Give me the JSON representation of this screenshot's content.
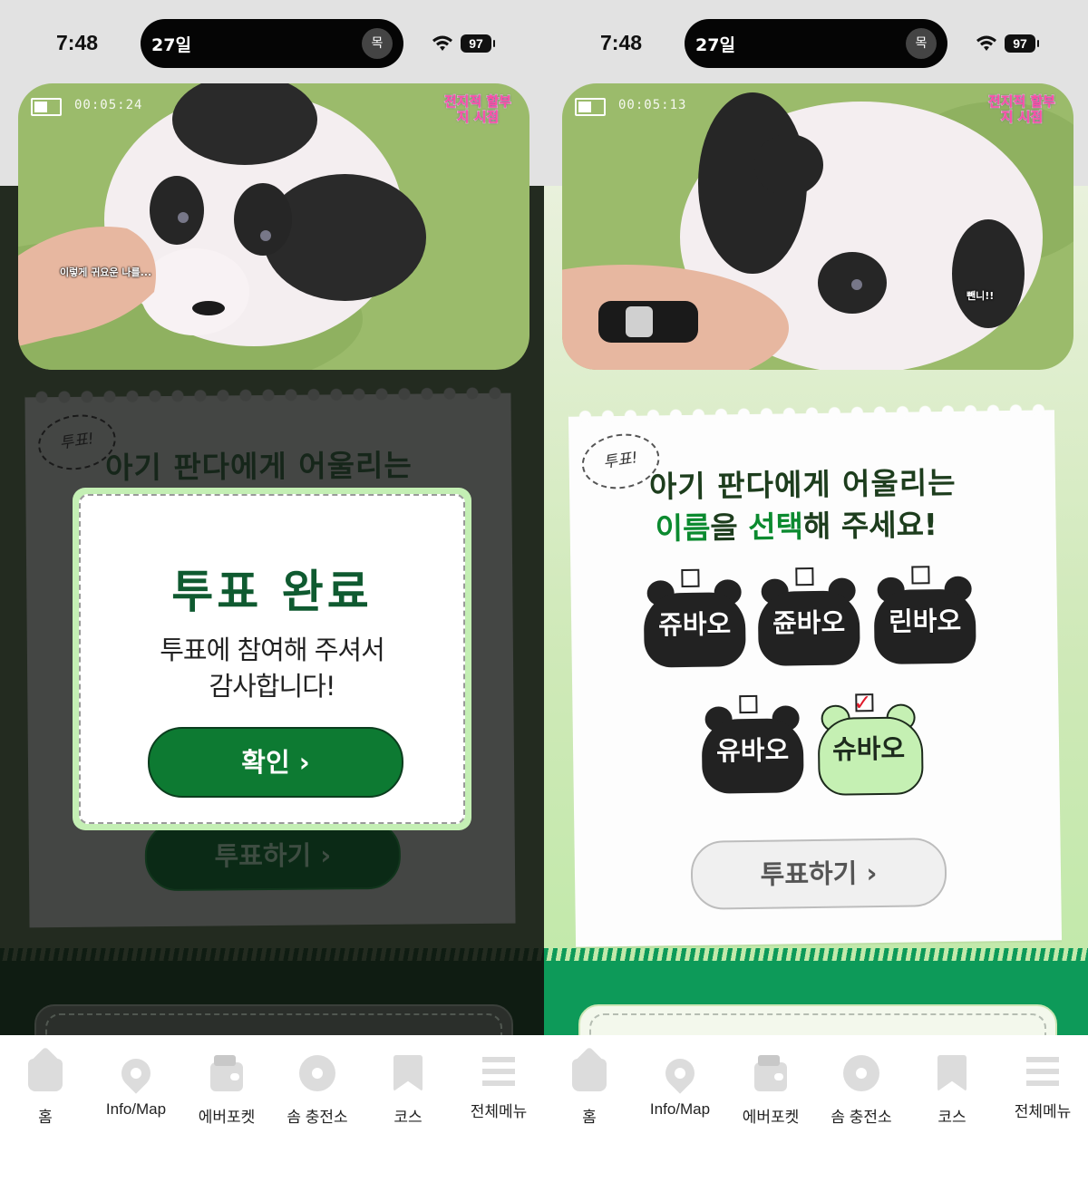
{
  "status_bar": {
    "time": "7:48",
    "island_date": "27일",
    "island_day": "목",
    "battery": "97"
  },
  "left": {
    "video": {
      "timecode": "00:05:24",
      "logo": "전지적 할부지 시점",
      "subtitle": "이렇게 귀요운 나를..."
    },
    "vote_tag": "투표!",
    "heading_line1": "아기 판다에게 어울리는",
    "vote_button": "투표하기 ›",
    "modal": {
      "title": "투표 완료",
      "message_line1": "투표에 참여해 주셔서",
      "message_line2": "감사합니다!",
      "ok_button": "확인 ›"
    }
  },
  "right": {
    "video": {
      "timecode": "00:05:13",
      "logo": "전지적 할부지 시점",
      "subtitle": "뺀니!!"
    },
    "vote_tag": "투표!",
    "heading_line1": "아기 판다에게 어울리는",
    "heading_line2_green1": "이름",
    "heading_line2_text1": "을 ",
    "heading_line2_green2": "선택",
    "heading_line2_text2": "해 주세요!",
    "choices": [
      "쥬바오",
      "쥰바오",
      "린바오",
      "유바오",
      "슈바오"
    ],
    "selected_choice": "슈바오",
    "vote_button": "투표하기 ›"
  },
  "tabbar": {
    "items": [
      "홈",
      "Info/Map",
      "에버포켓",
      "솜 충전소",
      "코스",
      "전체메뉴"
    ]
  },
  "colors": {
    "primary_green": "#0d7a32",
    "light_green": "#c5f0b3",
    "dark_overlay": "#232b20"
  }
}
